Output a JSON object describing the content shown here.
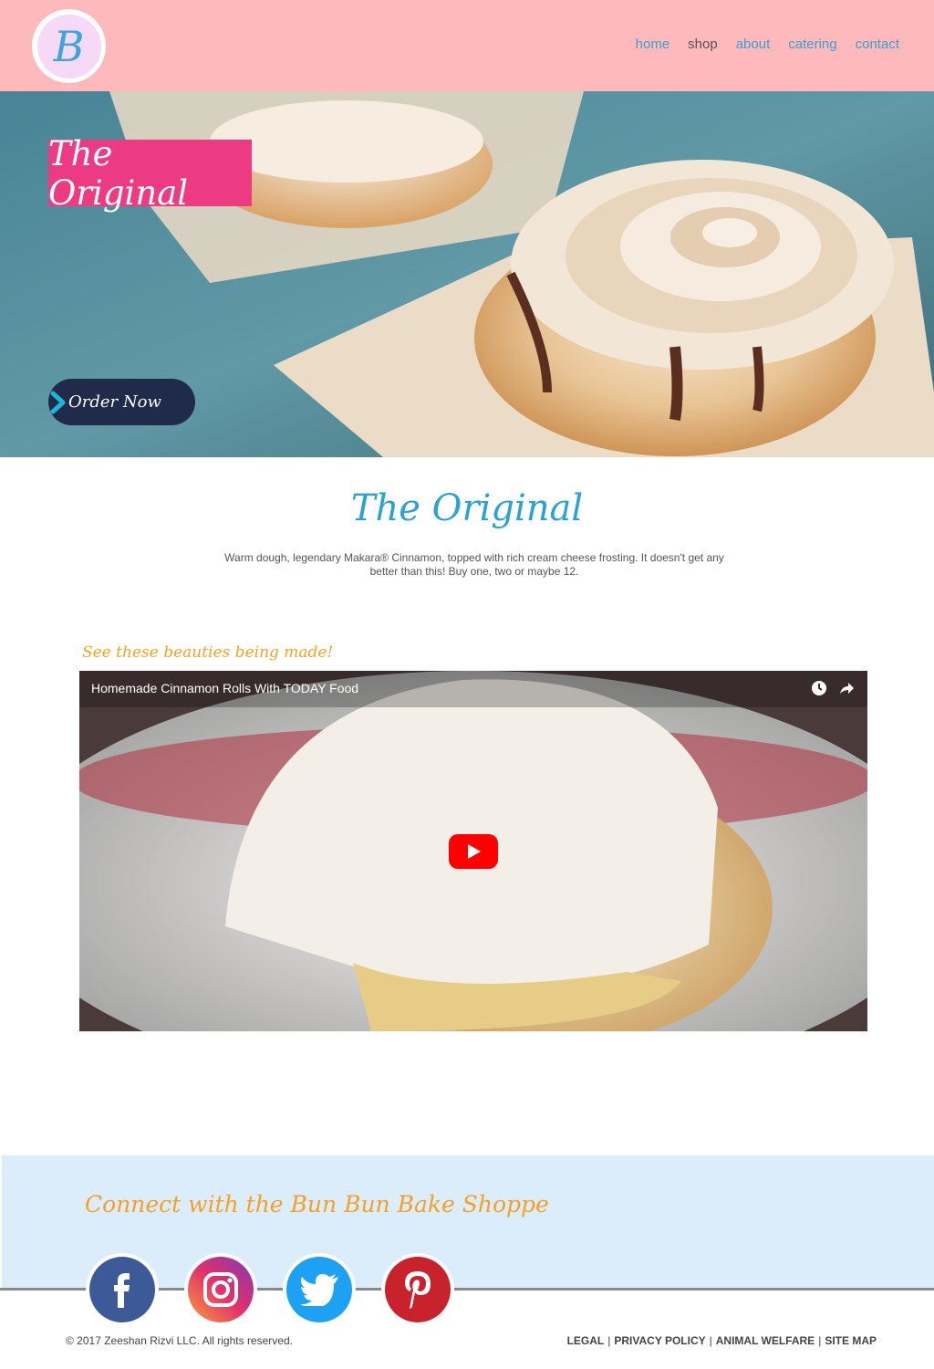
{
  "header": {
    "logo_letter": "B",
    "nav": [
      {
        "label": "home",
        "active": false
      },
      {
        "label": "shop",
        "active": true
      },
      {
        "label": "about",
        "active": false
      },
      {
        "label": "catering",
        "active": false
      },
      {
        "label": "contact",
        "active": false
      }
    ]
  },
  "hero": {
    "title": "The Original",
    "button_label": "Order Now"
  },
  "product": {
    "title": "The Original",
    "description": "Warm dough, legendary Makara® Cinnamon, topped with rich cream cheese frosting. It doesn't get any better than this! Buy one, two or maybe 12."
  },
  "video": {
    "caption": "See these beauties being made!",
    "title": "Homemade Cinnamon Rolls With TODAY Food"
  },
  "footer": {
    "title": "Connect with the Bun Bun Bake Shoppe",
    "social": [
      "facebook-icon",
      "instagram-icon",
      "twitter-icon",
      "pinterest-icon"
    ],
    "copyright": "© 2017 Zeeshan Rizvi LLC. All rights reserved.",
    "legal_links": [
      "LEGAL",
      "PRIVACY POLICY",
      "ANIMAL WELFARE",
      "SITE MAP"
    ]
  },
  "colors": {
    "header_bg": "#fdb9bb",
    "accent_pink": "#ec3b83",
    "accent_blue": "#2ba2d3",
    "accent_orange": "#f6a124",
    "button_navy": "#202a4b",
    "footer_bg": "#dbecfb"
  }
}
